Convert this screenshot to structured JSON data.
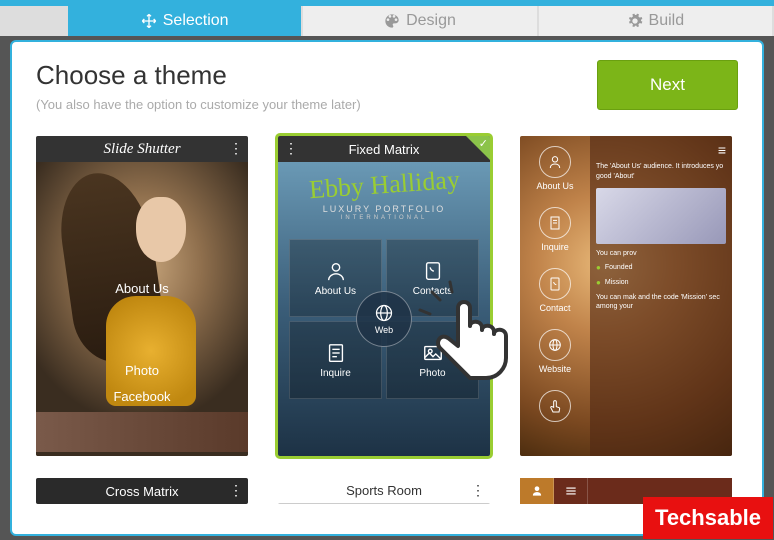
{
  "tabs": {
    "selection": "Selection",
    "design": "Design",
    "build": "Build"
  },
  "heading": {
    "title": "Choose a theme",
    "subtitle": "(You also have the option to customize your theme later)"
  },
  "next_label": "Next",
  "themes": {
    "t1": {
      "name": "Slide Shutter",
      "labels": {
        "about": "About Us",
        "photo": "Photo",
        "facebook": "Facebook"
      }
    },
    "t2": {
      "name": "Fixed Matrix",
      "script": "Ebby Halliday",
      "luxury": "LUXURY PORTFOLIO",
      "intl": "INTERNATIONAL",
      "cells": {
        "about": "About Us",
        "contacts": "Contacts",
        "inquire": "Inquire",
        "photo": "Photo",
        "web": "Web"
      }
    },
    "t3": {
      "icons": {
        "about": "About Us",
        "inquire": "Inquire",
        "contact": "Contact",
        "website": "Website"
      },
      "side": {
        "founded": "Founded",
        "mission": "Mission"
      }
    },
    "t4": {
      "name": "Cross Matrix"
    },
    "t5": {
      "name": "Sports Room"
    }
  },
  "watermark": "Techsable"
}
